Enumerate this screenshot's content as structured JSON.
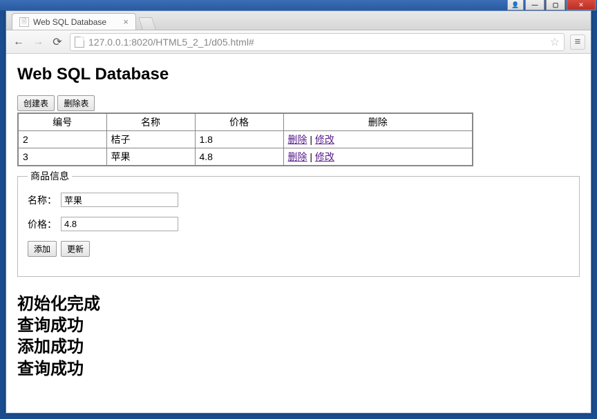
{
  "chrome": {
    "tab_title": "Web SQL Database",
    "url": "127.0.0.1:8020/HTML5_2_1/d05.html#"
  },
  "page": {
    "title": "Web SQL Database"
  },
  "toolbar": {
    "create_table": "创建表",
    "drop_table": "删除表"
  },
  "table": {
    "headers": {
      "id": "编号",
      "name": "名称",
      "price": "价格",
      "action": "删除"
    },
    "action_delete": "删除",
    "action_edit": "修改",
    "separator": " | ",
    "rows": [
      {
        "id": "2",
        "name": "桔子",
        "price": "1.8"
      },
      {
        "id": "3",
        "name": "苹果",
        "price": "4.8"
      }
    ]
  },
  "form": {
    "legend": "商品信息",
    "name_label": "名称：",
    "price_label": "价格：",
    "name_value": "苹果",
    "price_value": "4.8",
    "add_btn": "添加",
    "update_btn": "更新"
  },
  "status": {
    "messages": [
      "初始化完成",
      "查询成功",
      "添加成功",
      "查询成功"
    ]
  }
}
